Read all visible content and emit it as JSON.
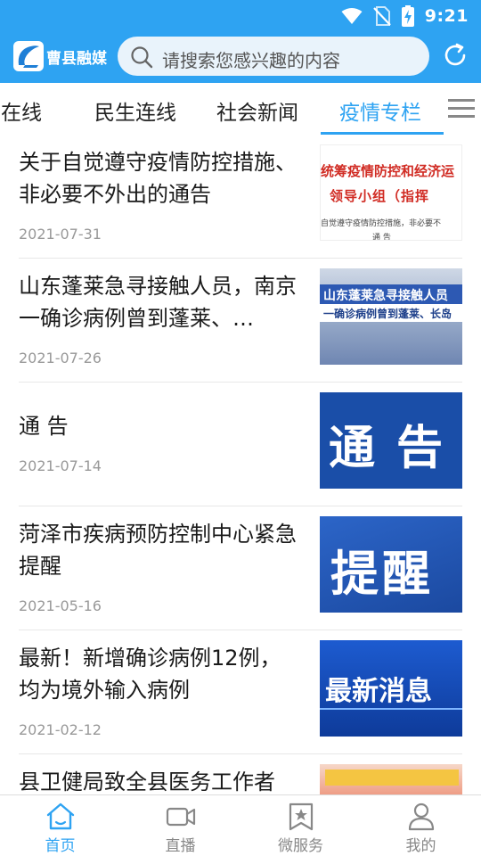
{
  "status_bar": {
    "time": "9:21",
    "icons": [
      "wifi-icon",
      "no-sim-icon",
      "battery-charging-icon"
    ]
  },
  "colors": {
    "brand": "#2ea3f2",
    "text": "#1a1a1a",
    "date": "#999999",
    "inactive_nav": "#888888"
  },
  "app_bar": {
    "brand_name": "曹县融媒",
    "search_placeholder": "请搜索您感兴趣的内容",
    "icons": [
      "app-logo-icon",
      "search-icon",
      "refresh-icon"
    ]
  },
  "tabs": {
    "items": [
      {
        "label": "主在线"
      },
      {
        "label": "民生连线"
      },
      {
        "label": "社会新闻"
      },
      {
        "label": "疫情专栏",
        "active": true
      }
    ],
    "menu_icon": "menu-icon"
  },
  "news": [
    {
      "title": "关于自觉遵守疫情防控措施、非必要不外出的通告",
      "date": "2021-07-31",
      "thumb": {
        "line1": "统筹疫情防控和经济运",
        "line2": "领导小组（指挥",
        "line3": "自觉遵守疫情防控措施，非必要不",
        "line4": "通 告"
      }
    },
    {
      "title": "山东蓬莱急寻接触人员，南京一确诊病例曾到蓬莱、…",
      "date": "2021-07-26",
      "thumb": {
        "line1": "山东蓬莱急寻接触人员",
        "line2": "一确诊病例曾到蓬莱、长岛"
      }
    },
    {
      "title": "通 告",
      "date": "2021-07-14",
      "thumb": {
        "text": "通告"
      }
    },
    {
      "title": "菏泽市疾病预防控制中心紧急提醒",
      "date": "2021-05-16",
      "thumb": {
        "text": "提醒"
      }
    },
    {
      "title": "最新！新增确诊病例12例，均为境外输入病例",
      "date": "2021-02-12",
      "thumb": {
        "text": "最新消息"
      }
    },
    {
      "title": "县卫健局致全县医务工作者",
      "date": ""
    }
  ],
  "bottom_nav": [
    {
      "label": "首页",
      "icon": "home-icon",
      "active": true
    },
    {
      "label": "直播",
      "icon": "video-icon"
    },
    {
      "label": "微服务",
      "icon": "bookmark-star-icon"
    },
    {
      "label": "我的",
      "icon": "user-icon"
    }
  ]
}
